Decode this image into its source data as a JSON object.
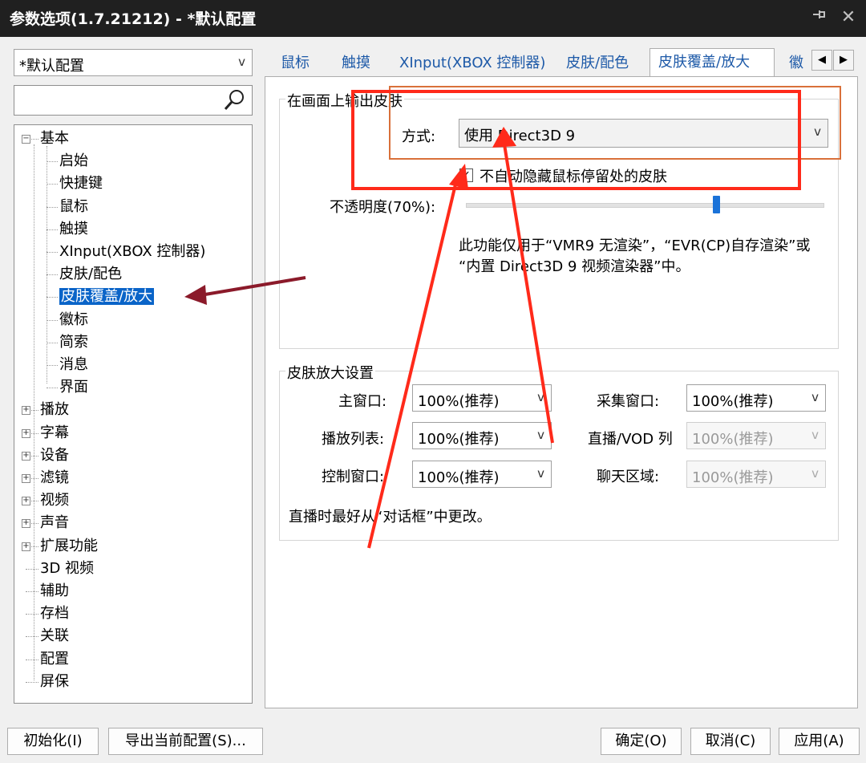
{
  "window": {
    "title": "参数选项(1.7.21212) - *默认配置",
    "pin_icon": "pin-icon",
    "close_icon": "close-icon"
  },
  "left": {
    "profile_select": "*默认配置",
    "search_placeholder": "",
    "tree": [
      {
        "label": "基本",
        "expanded": true
      },
      {
        "label": "启始"
      },
      {
        "label": "快捷键"
      },
      {
        "label": "鼠标"
      },
      {
        "label": "触摸"
      },
      {
        "label": "XInput(XBOX 控制器)"
      },
      {
        "label": "皮肤/配色"
      },
      {
        "label": "皮肤覆盖/放大",
        "selected": true
      },
      {
        "label": "徽标"
      },
      {
        "label": "简索"
      },
      {
        "label": "消息"
      },
      {
        "label": "界面"
      },
      {
        "label": "播放",
        "expander": "plus"
      },
      {
        "label": "字幕",
        "expander": "plus"
      },
      {
        "label": "设备",
        "expander": "plus"
      },
      {
        "label": "滤镜",
        "expander": "plus"
      },
      {
        "label": "视频",
        "expander": "plus"
      },
      {
        "label": "声音",
        "expander": "plus"
      },
      {
        "label": "扩展功能",
        "expander": "plus"
      },
      {
        "label": "3D 视频"
      },
      {
        "label": "辅助"
      },
      {
        "label": "存档"
      },
      {
        "label": "关联"
      },
      {
        "label": "配置"
      },
      {
        "label": "屏保"
      }
    ]
  },
  "tabs": [
    "鼠标",
    "触摸",
    "XInput(XBOX 控制器)",
    "皮肤/配色",
    "皮肤覆盖/放大",
    "徽"
  ],
  "active_tab": "皮肤覆盖/放大",
  "output_group": {
    "title": "在画面上输出皮肤",
    "mode_label": "方式:",
    "mode_value": "使用 Direct3D 9",
    "checkbox_label": "不自动隐藏鼠标停留处的皮肤",
    "checkbox_checked": true,
    "opacity_label": "不透明度(70%):",
    "opacity_value": 0.7,
    "note_line1": "此功能仅用于“VMR9 无渲染”，“EVR(CP)自存渲染”或",
    "note_line2": "“内置 Direct3D 9 视频渲染器”中。"
  },
  "zoom_group": {
    "title": "皮肤放大设置",
    "rows": [
      {
        "label": "主窗口:",
        "value": "100%(推荐)",
        "right_label": "采集窗口:",
        "right_value": "100%(推荐)",
        "right_disabled": false
      },
      {
        "label": "播放列表:",
        "value": "100%(推荐)",
        "right_label": "直播/VOD 列",
        "right_value": "100%(推荐)",
        "right_disabled": true
      },
      {
        "label": "控制窗口:",
        "value": "100%(推荐)",
        "right_label": "聊天区域:",
        "right_value": "100%(推荐)",
        "right_disabled": true
      }
    ],
    "note": "直播时最好从“对话框”中更改。"
  },
  "buttons": {
    "init": "初始化(I)",
    "export": "导出当前配置(S)...",
    "ok": "确定(O)",
    "cancel": "取消(C)",
    "apply": "应用(A)"
  },
  "annotation_colors": {
    "red": "#ff2a1a",
    "dark_red": "#8b1a2a",
    "orange": "#d9703a"
  }
}
